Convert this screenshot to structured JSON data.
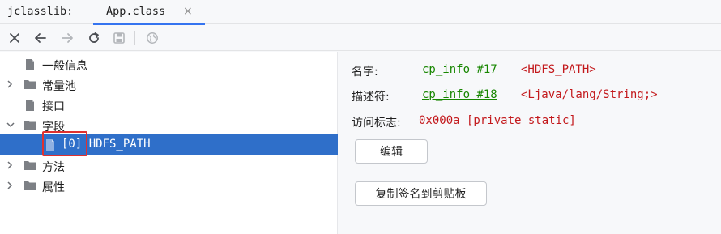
{
  "tabbar": {
    "tool_name": "jclasslib:",
    "active_tab": "App.class",
    "close_glyph": "×"
  },
  "toolbar": {
    "icons": [
      "close-icon",
      "back-arrow-icon",
      "forward-arrow-icon",
      "refresh-icon",
      "save-icon",
      "globe-icon"
    ]
  },
  "tree": {
    "items": [
      {
        "label": "一般信息",
        "icon": "file-icon",
        "expandable": false
      },
      {
        "label": "常量池",
        "icon": "folder-icon",
        "expandable": true,
        "expanded": false
      },
      {
        "label": "接口",
        "icon": "file-icon",
        "expandable": false
      },
      {
        "label": "字段",
        "icon": "folder-icon",
        "expandable": true,
        "expanded": true
      },
      {
        "label": "[0] HDFS_PATH",
        "icon": "file-icon",
        "expandable": false,
        "selected": true
      },
      {
        "label": "方法",
        "icon": "folder-icon",
        "expandable": true,
        "expanded": false
      },
      {
        "label": "属性",
        "icon": "folder-icon",
        "expandable": true,
        "expanded": false
      }
    ]
  },
  "detail": {
    "name_label": "名字:",
    "name_link": "cp_info #17",
    "name_value": "<HDFS_PATH>",
    "descriptor_label": "描述符:",
    "descriptor_link": "cp_info #18",
    "descriptor_value": "<Ljava/lang/String;>",
    "access_label": "访问标志:",
    "access_value": "0x000a [private static]",
    "edit_button": "编辑",
    "copy_button": "复制签名到剪贴板"
  },
  "colors": {
    "accent": "#3574f0",
    "selection": "#2f6fc9",
    "link": "#178600",
    "value": "#c3181b",
    "highlight": "#e0312f"
  }
}
